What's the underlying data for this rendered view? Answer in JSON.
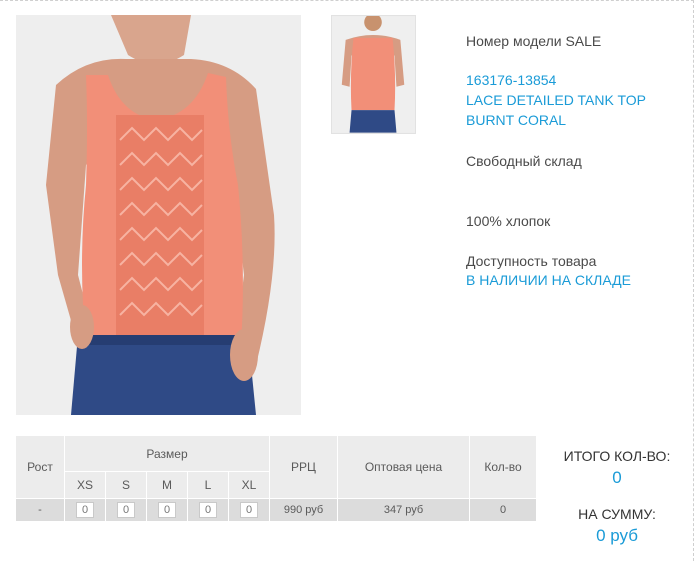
{
  "product": {
    "model_label": "Номер модели SALE",
    "code": "163176-13854",
    "name_line1": "LACE DETAILED TANK TOP",
    "name_line2": "BURNT CORAL",
    "warehouse": "Свободный склад",
    "material": "100% хлопок",
    "availability_label": "Доступность товара",
    "availability_value": "В НАЛИЧИИ НА СКЛАДЕ"
  },
  "images": {
    "main_alt": "coral lace tank top main photo",
    "thumb_alt": "coral lace tank top back view thumbnail"
  },
  "colors": {
    "link": "#1a9bd7",
    "garment": "#f28f78",
    "header_bg": "#ececec",
    "row_bg": "#dcdcdc"
  },
  "table": {
    "headers": {
      "height": "Рост",
      "size": "Размер",
      "rrp": "РРЦ",
      "wholesale": "Оптовая цена",
      "qty": "Кол-во"
    },
    "sizes": [
      "XS",
      "S",
      "M",
      "L",
      "XL"
    ],
    "row": {
      "height": "-",
      "size_qty": [
        "0",
        "0",
        "0",
        "0",
        "0"
      ],
      "rrp": "990 руб",
      "wholesale": "347 руб",
      "qty": "0"
    }
  },
  "totals": {
    "qty_label": "ИТОГО КОЛ-ВО:",
    "qty_value": "0",
    "sum_label": "НА СУММУ:",
    "sum_value": "0 руб"
  }
}
